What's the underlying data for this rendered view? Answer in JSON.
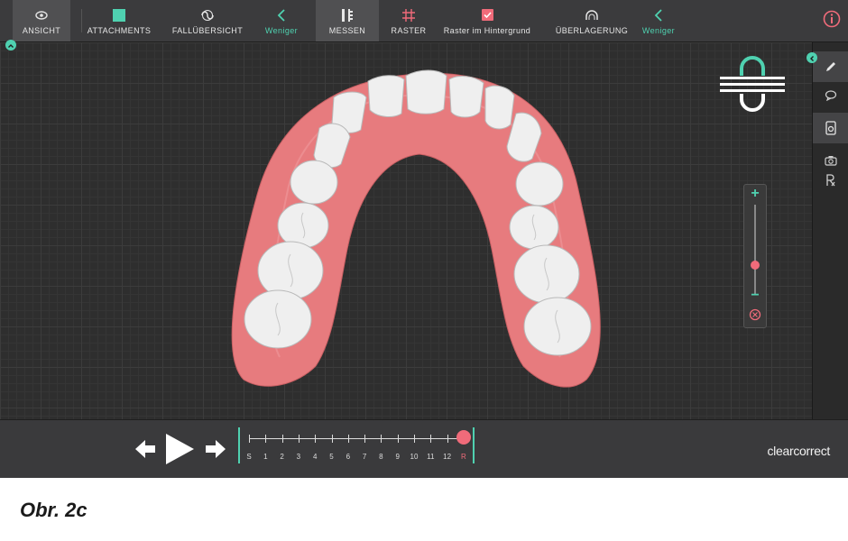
{
  "toolbar": {
    "ansicht": "ANSICHT",
    "attachments": "ATTACHMENTS",
    "falluebersicht": "FALLÜBERSICHT",
    "weniger_left": "Weniger",
    "messen": "MESSEN",
    "raster": "RASTER",
    "raster_hintergrund": "Raster im Hintergrund",
    "ueberlagerung": "ÜBERLAGERUNG",
    "weniger_right": "Weniger"
  },
  "icons": {
    "view": "eye-icon",
    "attachments": "square-icon",
    "overview": "swirl-icon",
    "back": "chevron-left-icon",
    "measure": "ruler-icon",
    "grid": "grid-icon",
    "checkbox": "checkbox-checked-icon",
    "overlay": "arch-icon",
    "info": "info-icon"
  },
  "timeline": {
    "stages": [
      "S",
      "1",
      "2",
      "3",
      "4",
      "5",
      "6",
      "7",
      "8",
      "9",
      "10",
      "11",
      "12",
      "R"
    ],
    "current": "R"
  },
  "brand": "clearcorrect",
  "caption": "Obr. 2c",
  "colors": {
    "accent": "#4fd1b0",
    "highlight": "#f06b7a",
    "gum": "#e77b7e",
    "teeth": "#eeeeee"
  }
}
